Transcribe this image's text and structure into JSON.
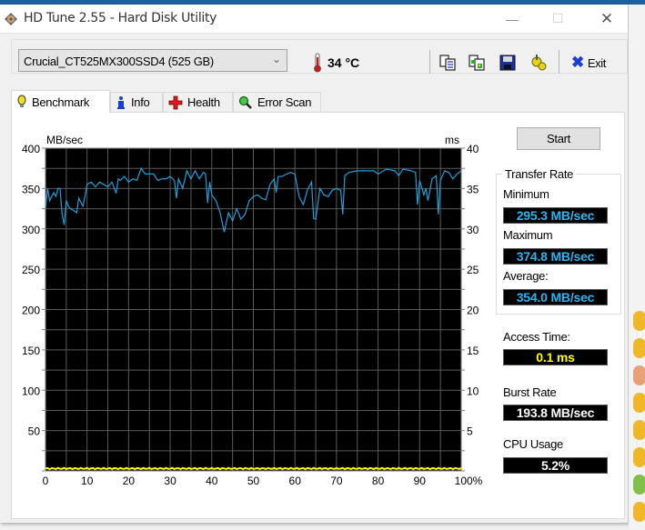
{
  "window": {
    "title": "HD Tune 2.55 - Hard Disk Utility",
    "controls": {
      "minimize": "—",
      "maximize": "☐",
      "close": "✕"
    }
  },
  "toolbar": {
    "drive": "Crucial_CT525MX300SSD4 (525 GB)",
    "temperature": "34 °C",
    "icons": [
      "copy-text-icon",
      "copy-screenshot-icon",
      "save-icon",
      "options-icon"
    ],
    "exit_label": "Exit"
  },
  "tabs": [
    {
      "label": "Benchmark",
      "icon": "bulb-icon",
      "active": true
    },
    {
      "label": "Info",
      "icon": "info-icon",
      "active": false
    },
    {
      "label": "Health",
      "icon": "health-cross-icon",
      "active": false
    },
    {
      "label": "Error Scan",
      "icon": "magnifier-icon",
      "active": false
    }
  ],
  "controls": {
    "start_label": "Start"
  },
  "results": {
    "transfer_rate_title": "Transfer Rate",
    "minimum_label": "Minimum",
    "minimum_value": "295.3 MB/sec",
    "maximum_label": "Maximum",
    "maximum_value": "374.8 MB/sec",
    "average_label": "Average:",
    "average_value": "354.0 MB/sec",
    "access_time_label": "Access Time:",
    "access_time_value": "0.1 ms",
    "burst_rate_label": "Burst Rate",
    "burst_rate_value": "193.8 MB/sec",
    "cpu_usage_label": "CPU Usage",
    "cpu_usage_value": "5.2%"
  },
  "colors": {
    "transfer_line": "#1ea0dc",
    "access_line": "#ffff00",
    "value_text_blue": "#2ab4f0",
    "value_text_yellow": "#ffff00",
    "value_text_white": "#ffffff"
  },
  "chart_data": {
    "type": "line",
    "title": "",
    "xlabel": "",
    "ylabel": "MB/sec",
    "y2label": "ms",
    "xlim": [
      0,
      100
    ],
    "ylim": [
      0,
      400
    ],
    "y2lim": [
      0,
      40
    ],
    "x_ticks": [
      "0",
      "10",
      "20",
      "30",
      "40",
      "50",
      "60",
      "70",
      "80",
      "90",
      "100%"
    ],
    "y_ticks": [
      "400",
      "350",
      "300",
      "250",
      "200",
      "150",
      "100",
      "50"
    ],
    "y2_ticks": [
      "40",
      "35",
      "30",
      "25",
      "20",
      "15",
      "10",
      "5"
    ],
    "grid": true,
    "series": [
      {
        "name": "Transfer Rate",
        "axis": "left",
        "x": [
          0,
          0.5,
          1,
          2,
          2.5,
          3,
          3.5,
          4,
          4.5,
          5,
          5.5,
          6,
          7,
          7.5,
          8,
          9,
          9.5,
          10,
          11,
          12,
          13,
          14,
          15,
          16,
          17,
          17.5,
          18,
          19,
          20,
          21,
          22,
          23,
          24,
          25,
          26,
          27,
          28,
          29,
          30,
          31,
          31.5,
          32,
          33,
          34,
          35,
          36,
          37,
          38,
          38.5,
          39,
          39.5,
          40,
          41,
          42,
          43,
          44,
          45,
          46,
          47,
          48,
          49,
          50,
          51,
          52,
          53,
          54,
          55,
          55.5,
          56,
          57,
          58,
          59,
          60,
          61,
          62,
          63,
          64,
          64.5,
          65,
          66,
          67,
          68,
          69,
          70,
          71,
          71.5,
          72,
          73,
          75,
          77,
          79,
          80,
          82,
          84,
          85,
          86,
          88,
          89,
          89.5,
          90,
          91,
          91.5,
          92,
          93,
          94,
          94.5,
          95,
          96,
          97,
          98,
          99,
          100
        ],
        "values": [
          325,
          350,
          335,
          345,
          340,
          350,
          350,
          318,
          305,
          335,
          328,
          325,
          322,
          320,
          338,
          328,
          340,
          355,
          358,
          352,
          358,
          355,
          352,
          358,
          344,
          362,
          360,
          365,
          358,
          362,
          360,
          375,
          368,
          368,
          368,
          360,
          362,
          362,
          365,
          360,
          338,
          362,
          350,
          372,
          362,
          372,
          362,
          370,
          368,
          332,
          358,
          342,
          335,
          320,
          296,
          320,
          310,
          325,
          312,
          318,
          335,
          340,
          342,
          338,
          336,
          355,
          362,
          345,
          365,
          365,
          368,
          370,
          368,
          340,
          330,
          348,
          358,
          313,
          312,
          350,
          342,
          340,
          348,
          350,
          348,
          318,
          366,
          370,
          372,
          372,
          372,
          368,
          374,
          372,
          366,
          374,
          372,
          370,
          330,
          360,
          342,
          350,
          335,
          362,
          366,
          318,
          360,
          372,
          370,
          362,
          368,
          372
        ]
      },
      {
        "name": "Access Time",
        "axis": "right",
        "x": [
          0,
          100
        ],
        "values": [
          0.1,
          0.1
        ]
      }
    ],
    "legend": "none"
  }
}
